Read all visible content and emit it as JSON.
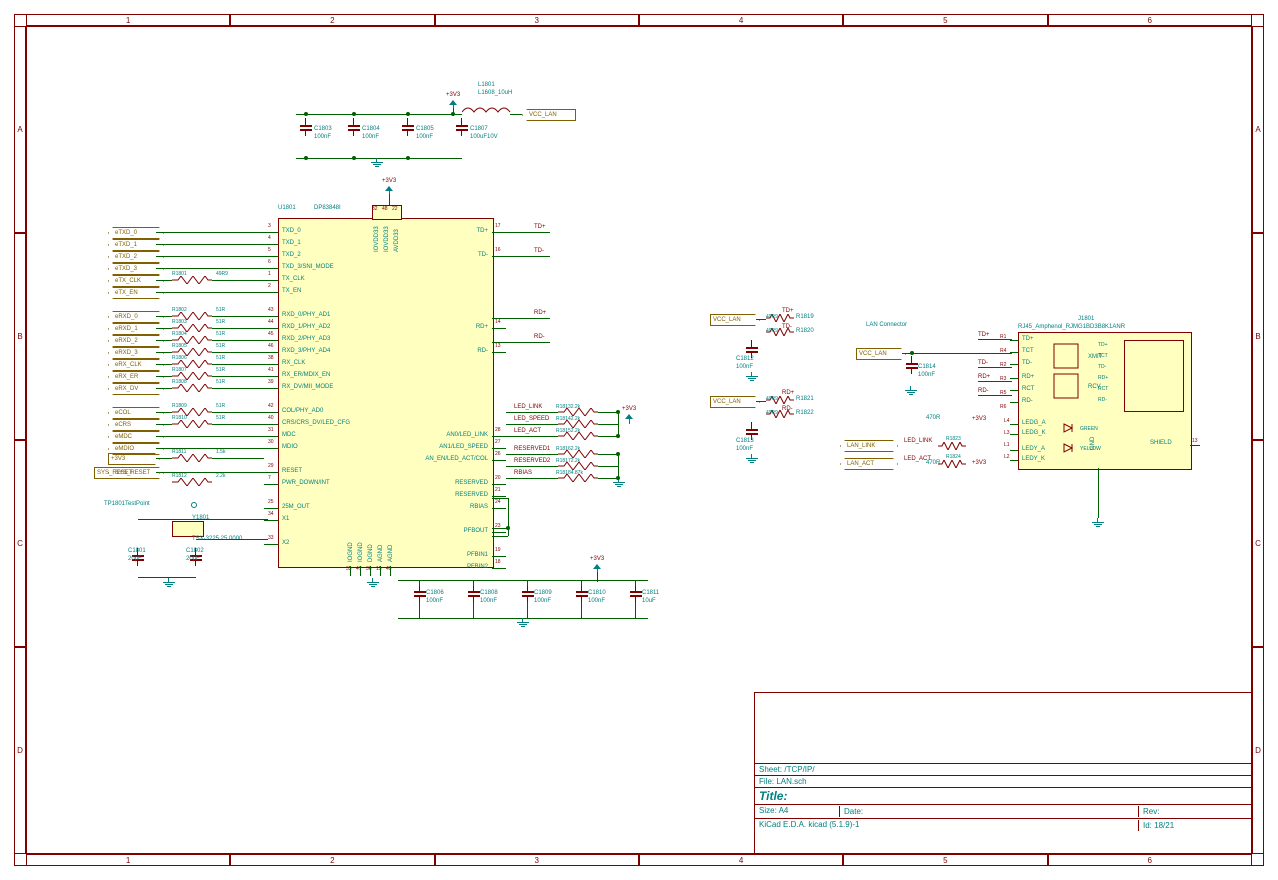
{
  "frame": {
    "top_numbers": [
      "1",
      "2",
      "3",
      "4",
      "5",
      "6"
    ],
    "side_letters": [
      "A",
      "B",
      "C",
      "D"
    ]
  },
  "titleblock": {
    "sheet": "Sheet: /TCP/IP/",
    "file": "File: LAN.sch",
    "title": "Title:",
    "size": "Size: A4",
    "date": "Date:",
    "rev": "Rev:",
    "tool": "KiCad E.D.A.  kicad (5.1.9)-1",
    "id": "Id: 18/21"
  },
  "main_ic": {
    "ref": "U1801",
    "value": "DP83848I",
    "left_pins": [
      {
        "num": "3",
        "name": "TXD_0"
      },
      {
        "num": "4",
        "name": "TXD_1"
      },
      {
        "num": "5",
        "name": "TXD_2"
      },
      {
        "num": "6",
        "name": "TXD_3/SNI_MODE"
      },
      {
        "num": "1",
        "name": "TX_CLK"
      },
      {
        "num": "2",
        "name": "TX_EN"
      },
      {
        "num": "",
        "name": ""
      },
      {
        "num": "43",
        "name": "RXD_0/PHY_AD1"
      },
      {
        "num": "44",
        "name": "RXD_1/PHY_AD2"
      },
      {
        "num": "45",
        "name": "RXD_2/PHY_AD3"
      },
      {
        "num": "46",
        "name": "RXD_3/PHY_AD4"
      },
      {
        "num": "38",
        "name": "RX_CLK"
      },
      {
        "num": "41",
        "name": "RX_ER/MDIX_EN"
      },
      {
        "num": "39",
        "name": "RX_DV/MII_MODE"
      },
      {
        "num": "",
        "name": ""
      },
      {
        "num": "42",
        "name": "COL/PHY_AD0"
      },
      {
        "num": "40",
        "name": "CRS/CRS_DV/LED_CFG"
      },
      {
        "num": "31",
        "name": "MDC"
      },
      {
        "num": "30",
        "name": "MDIO"
      },
      {
        "num": "",
        "name": ""
      },
      {
        "num": "29",
        "name": "RESET"
      },
      {
        "num": "7",
        "name": "PWR_DOWN/INT"
      },
      {
        "num": "",
        "name": ""
      },
      {
        "num": "25",
        "name": "25M_OUT"
      },
      {
        "num": "34",
        "name": "X1"
      },
      {
        "num": "",
        "name": ""
      },
      {
        "num": "33",
        "name": "X2"
      }
    ],
    "right_pins": [
      {
        "num": "17",
        "name": "TD+"
      },
      {
        "num": "",
        "name": ""
      },
      {
        "num": "16",
        "name": "TD-"
      },
      {
        "num": "",
        "name": ""
      },
      {
        "num": "",
        "name": ""
      },
      {
        "num": "",
        "name": ""
      },
      {
        "num": "",
        "name": ""
      },
      {
        "num": "",
        "name": ""
      },
      {
        "num": "14",
        "name": "RD+"
      },
      {
        "num": "",
        "name": ""
      },
      {
        "num": "13",
        "name": "RD-"
      },
      {
        "num": "",
        "name": ""
      },
      {
        "num": "",
        "name": ""
      },
      {
        "num": "",
        "name": ""
      },
      {
        "num": "",
        "name": ""
      },
      {
        "num": "",
        "name": ""
      },
      {
        "num": "",
        "name": ""
      },
      {
        "num": "28",
        "name": "AN0/LED_LINK"
      },
      {
        "num": "27",
        "name": "AN1/LED_SPEED"
      },
      {
        "num": "26",
        "name": "AN_EN/LED_ACT/COL"
      },
      {
        "num": "",
        "name": ""
      },
      {
        "num": "20",
        "name": "RESERVED"
      },
      {
        "num": "21",
        "name": "RESERVED"
      },
      {
        "num": "24",
        "name": "RBIAS"
      },
      {
        "num": "",
        "name": ""
      },
      {
        "num": "23",
        "name": "PFBOUT"
      },
      {
        "num": "",
        "name": ""
      },
      {
        "num": "19",
        "name": "PFBIN1"
      },
      {
        "num": "18",
        "name": "PFBIN2"
      }
    ],
    "top_pins": [
      {
        "num": "32",
        "name": "IOVDD33"
      },
      {
        "num": "48",
        "name": "IOVDD33"
      },
      {
        "num": "22",
        "name": "AVDD33"
      }
    ],
    "bottom_pins": [
      {
        "num": "35",
        "name": "IOGND"
      },
      {
        "num": "47",
        "name": "IOGND"
      },
      {
        "num": "36",
        "name": "DGND"
      },
      {
        "num": "15",
        "name": "AGND"
      },
      {
        "num": "49",
        "name": "AGND"
      }
    ]
  },
  "top_power": {
    "rail": "+3V3",
    "vcc": "VCC_LAN"
  },
  "caps_top": [
    {
      "ref": "C1803",
      "val": "100nF"
    },
    {
      "ref": "C1804",
      "val": "100nF"
    },
    {
      "ref": "C1805",
      "val": "100nF"
    },
    {
      "ref": "C1807",
      "val": "100uF10V"
    }
  ],
  "inductor": {
    "ref": "L1801",
    "val": "L1608_10uH"
  },
  "caps_bottom": [
    {
      "ref": "C1806",
      "val": "100nF"
    },
    {
      "ref": "C1808",
      "val": "100nF"
    },
    {
      "ref": "C1809",
      "val": "100nF"
    },
    {
      "ref": "C1810",
      "val": "100nF"
    },
    {
      "ref": "C1811",
      "val": "10uF"
    }
  ],
  "bottom_power": "+3V3",
  "left_hier": [
    "eTXD_0",
    "eTXD_1",
    "eTXD_2",
    "eTXD_3",
    "eTX_CLK",
    "eTX_EN",
    "eRXD_0",
    "eRXD_1",
    "eRXD_2",
    "eRXD_3",
    "eRX_CLK",
    "eRX_ER",
    "eRX_DV",
    "eCOL",
    "eCRS",
    "eMDC",
    "eMDIO",
    "+3V3",
    "SYS_RESET"
  ],
  "left_resistors": [
    {
      "ref": "R1801",
      "val": "49R9"
    },
    {
      "ref": "R1802",
      "val": "51R"
    },
    {
      "ref": "R1803",
      "val": "51R"
    },
    {
      "ref": "R1804",
      "val": "51R"
    },
    {
      "ref": "R1805",
      "val": "51R"
    },
    {
      "ref": "R1806",
      "val": "51R"
    },
    {
      "ref": "R1807",
      "val": "51R"
    },
    {
      "ref": "R1808",
      "val": "51R"
    },
    {
      "ref": "R1809",
      "val": "51R"
    },
    {
      "ref": "R1810",
      "val": "51R"
    },
    {
      "ref": "R1811",
      "val": "1.5k"
    },
    {
      "ref": "R1812",
      "val": "2.2k"
    }
  ],
  "xtal": {
    "tp": "TP1801TestPoint",
    "ref": "Y1801",
    "val": "TSX-3225 25.0000",
    "c1": {
      "ref": "C1801",
      "val": "20pF"
    },
    "c2": {
      "ref": "C1802",
      "val": "20pF"
    }
  },
  "right_nets": [
    "TD+",
    "TD-",
    "RD+",
    "RD-"
  ],
  "led_nets": [
    "LED_LINK",
    "LED_SPEED",
    "LED_ACT",
    "RESERVED1",
    "RESERVED2",
    "RBIAS"
  ],
  "led_resistors": [
    {
      "ref": "R1813",
      "val": "2.2k"
    },
    {
      "ref": "R1814",
      "val": "2.2k"
    },
    {
      "ref": "R1815",
      "val": "2.2k"
    },
    {
      "ref": "R1816",
      "val": "2.2k"
    },
    {
      "ref": "R1817",
      "val": "2.2k"
    },
    {
      "ref": "R1818",
      "val": "4.87k"
    }
  ],
  "led_rail": "+3V3",
  "mid_block": {
    "vcc_top": "VCC_LAN",
    "td_plus": "TD+",
    "td_minus": "TD-",
    "r19": {
      "ref": "R1819",
      "val": "49R9"
    },
    "r20": {
      "ref": "R1820",
      "val": "49R9"
    },
    "c12": {
      "ref": "C1812",
      "val": "100nF"
    },
    "vcc_bot": "VCC_LAN",
    "rd_plus": "RD+",
    "rd_minus": "RD-",
    "r21": {
      "ref": "R1821",
      "val": "49R9"
    },
    "r22": {
      "ref": "R1822",
      "val": "49R9"
    },
    "c13": {
      "ref": "C1813",
      "val": "100nF"
    }
  },
  "lan_block": {
    "title": "LAN Connector",
    "vcc": "VCC_LAN",
    "c14": {
      "ref": "C1814",
      "val": "100nF"
    },
    "r23": {
      "ref": "R1823",
      "val": "470R"
    },
    "r24": {
      "ref": "R1824",
      "val": "470R"
    },
    "led_rail": "+3V3",
    "lan_link": "LAN_LINK",
    "lan_act": "LAN_ACT",
    "led_link": "LED_LINK",
    "led_act": "LED_ACT"
  },
  "rj45": {
    "ref": "J1801",
    "val": "RJ45_Amphenol_RJMG1BD3B8K1ANR",
    "right_sig": [
      "TD+",
      "TCT",
      "TD-",
      "RD+",
      "RCT",
      "RD-"
    ],
    "right_pins": [
      "R1",
      "R4",
      "R2",
      "R3",
      "R5",
      "R6"
    ],
    "nets_td": [
      "TD+",
      "TD-"
    ],
    "nets_rd": [
      "RD+",
      "RD-"
    ],
    "left_pins": [
      "TD+",
      "TCT",
      "TD-",
      "RD+",
      "RCT",
      "RD-",
      "",
      "LEDG_A",
      "LEDG_K",
      "LEDY_A",
      "LEDY_K"
    ],
    "led_pins": [
      "L4",
      "L3",
      "L1",
      "L2"
    ],
    "inner": [
      "XMIT",
      "RCV",
      "GREEN",
      "YELLOW"
    ],
    "shield": "SHIELD",
    "shield_pin": "13",
    "gnd": "GND"
  }
}
